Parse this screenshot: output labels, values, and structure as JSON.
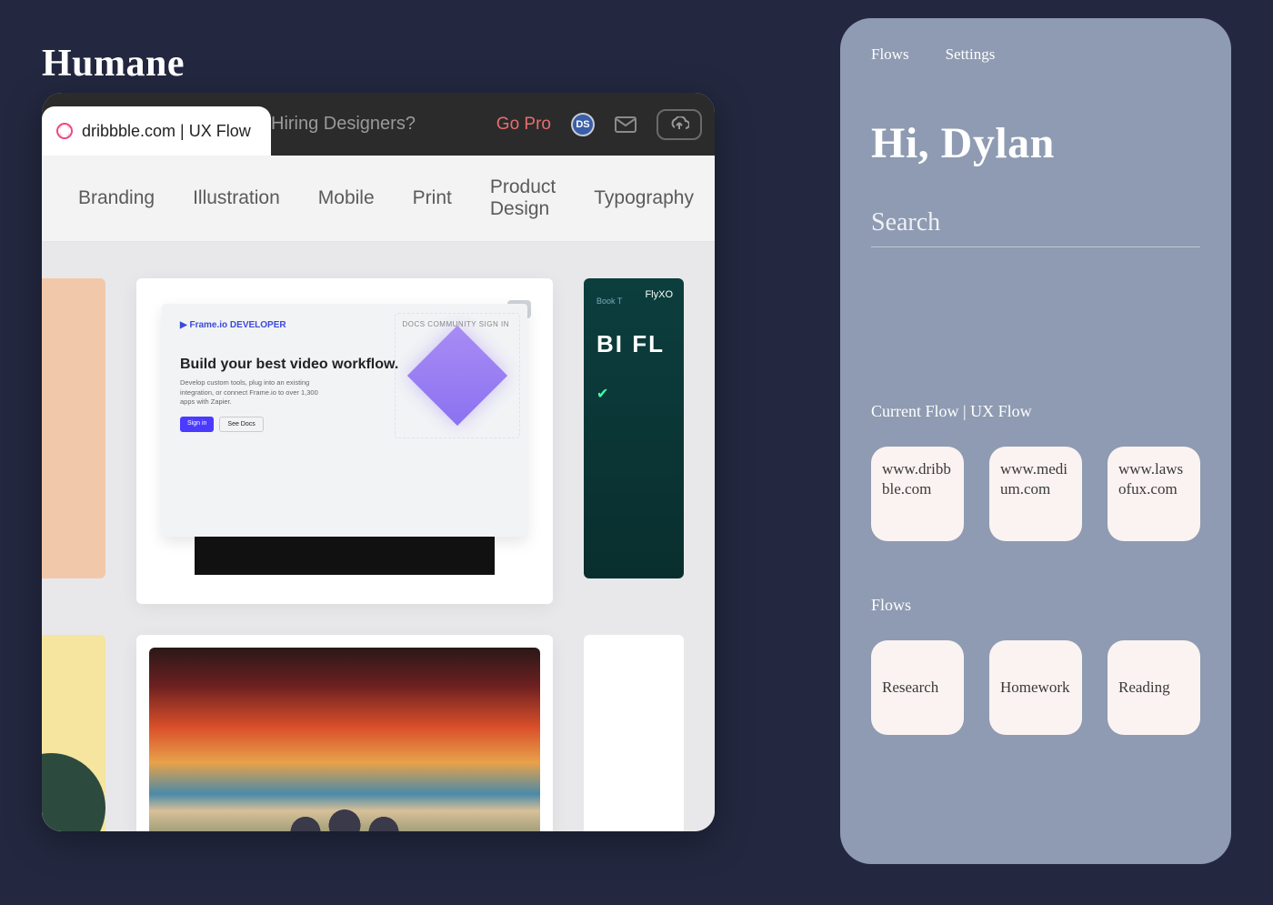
{
  "app": {
    "title": "Humane"
  },
  "browser": {
    "tab_label": "dribbble.com | UX Flow",
    "hiring": "Hiring Designers?",
    "go_pro": "Go Pro",
    "avatar_initials": "DS",
    "categories": [
      "Branding",
      "Illustration",
      "Mobile",
      "Print",
      "Product Design",
      "Typography"
    ],
    "shot1": {
      "logo": "▶ Frame.io DEVELOPER",
      "nav": "DOCS   COMMUNITY   SIGN IN",
      "heading": "Build your best video workflow.",
      "sub": "Develop custom tools, plug into an existing integration, or connect Frame.io to over 1,300 apps with Zapier.",
      "btn1": "Sign in",
      "btn2": "See Docs"
    },
    "shot_right": {
      "logo": "FlyXO",
      "small": "Book T",
      "big": "BI\nFL",
      "tick": "✔"
    }
  },
  "panel": {
    "tabs": {
      "flows": "Flows",
      "settings": "Settings"
    },
    "greeting": "Hi, Dylan",
    "search_placeholder": "Search",
    "current_flow_label": "Current Flow | UX Flow",
    "sites": [
      "www.dribbble.com",
      "www.medium.com",
      "www.lawsofux.com"
    ],
    "flows_label": "Flows",
    "flows": [
      "Research",
      "Homework",
      "Reading"
    ]
  }
}
